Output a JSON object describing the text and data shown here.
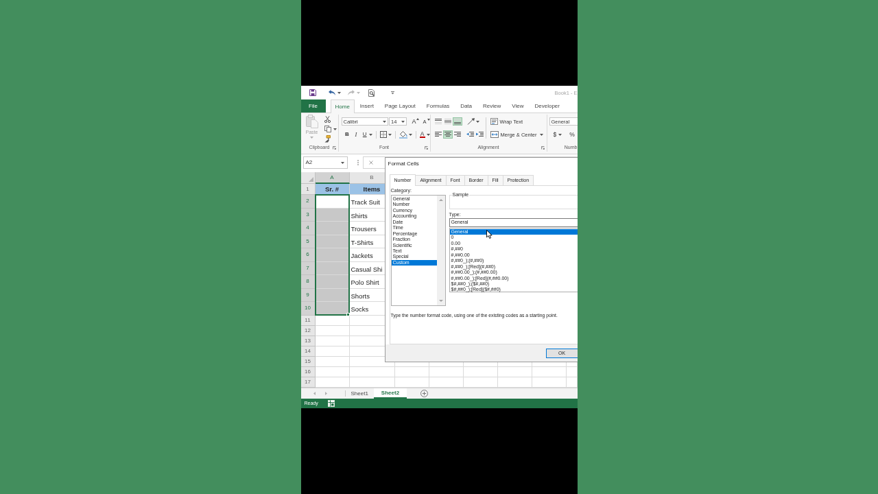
{
  "window": {
    "title": "Book1 - E"
  },
  "quick_access": {
    "undo": {
      "disabled": false
    },
    "redo": {
      "disabled": true
    }
  },
  "ribbon_tabs": [
    {
      "label": "File",
      "kind": "file",
      "selected": false
    },
    {
      "label": "Home",
      "kind": "tab",
      "selected": true
    },
    {
      "label": "Insert",
      "kind": "tab",
      "selected": false
    },
    {
      "label": "Page Layout",
      "kind": "tab",
      "selected": false
    },
    {
      "label": "Formulas",
      "kind": "tab",
      "selected": false
    },
    {
      "label": "Data",
      "kind": "tab",
      "selected": false
    },
    {
      "label": "Review",
      "kind": "tab",
      "selected": false
    },
    {
      "label": "View",
      "kind": "tab",
      "selected": false
    },
    {
      "label": "Developer",
      "kind": "tab",
      "selected": false
    }
  ],
  "ribbon": {
    "clipboard": {
      "label": "Clipboard",
      "paste": {
        "label": "Paste",
        "disabled": true
      }
    },
    "font": {
      "label": "Font",
      "font_name": "Calibri",
      "font_size": "14",
      "grow": "A",
      "shrink": "A",
      "bold": "B",
      "italic": "I",
      "underline": "U",
      "font_color": "A"
    },
    "alignment": {
      "label": "Alignment",
      "vertical": [
        {
          "kind": "top",
          "selected": false
        },
        {
          "kind": "middle",
          "selected": false
        },
        {
          "kind": "bottom",
          "selected": true
        }
      ],
      "horizontal": [
        {
          "kind": "left",
          "selected": false
        },
        {
          "kind": "center",
          "selected": true
        },
        {
          "kind": "right",
          "selected": false
        }
      ],
      "wrap_text": "Wrap Text",
      "merge": "Merge & Center"
    },
    "number": {
      "label": "Numb",
      "format": "General",
      "currency": "$",
      "percent": "%"
    }
  },
  "formula_bar": {
    "name_box": "A2"
  },
  "sheet": {
    "columns": [
      {
        "label": "A",
        "selected": true
      },
      {
        "label": "B",
        "selected": false
      }
    ],
    "rows": [
      {
        "label": "1",
        "selected": false,
        "cells": [
          {
            "kind": "header",
            "text": "Sr. #",
            "selected": false,
            "active": false
          },
          {
            "kind": "header",
            "text": "Items",
            "selected": false,
            "active": false
          }
        ]
      },
      {
        "label": "2",
        "selected": true,
        "cells": [
          {
            "kind": "data",
            "selected": true,
            "active": true
          },
          {
            "kind": "data",
            "text": "Track Suit",
            "selected": false,
            "active": false
          }
        ]
      },
      {
        "label": "3",
        "selected": true,
        "cells": [
          {
            "kind": "data",
            "selected": true,
            "active": false
          },
          {
            "kind": "data",
            "text": "Shirts",
            "selected": false,
            "active": false
          }
        ]
      },
      {
        "label": "4",
        "selected": true,
        "cells": [
          {
            "kind": "data",
            "selected": true,
            "active": false
          },
          {
            "kind": "data",
            "text": "Trousers",
            "selected": false,
            "active": false
          }
        ]
      },
      {
        "label": "5",
        "selected": true,
        "cells": [
          {
            "kind": "data",
            "selected": true,
            "active": false
          },
          {
            "kind": "data",
            "text": "T-Shirts",
            "selected": false,
            "active": false
          }
        ]
      },
      {
        "label": "6",
        "selected": true,
        "cells": [
          {
            "kind": "data",
            "selected": true,
            "active": false
          },
          {
            "kind": "data",
            "text": "Jackets",
            "selected": false,
            "active": false
          }
        ]
      },
      {
        "label": "7",
        "selected": true,
        "cells": [
          {
            "kind": "data",
            "selected": true,
            "active": false
          },
          {
            "kind": "data",
            "text": "Casual Shi",
            "selected": false,
            "active": false
          }
        ]
      },
      {
        "label": "8",
        "selected": true,
        "cells": [
          {
            "kind": "data",
            "selected": true,
            "active": false
          },
          {
            "kind": "data",
            "text": "Polo Shirt",
            "selected": false,
            "active": false
          }
        ]
      },
      {
        "label": "9",
        "selected": true,
        "cells": [
          {
            "kind": "data",
            "selected": true,
            "active": false
          },
          {
            "kind": "data",
            "text": "Shorts",
            "selected": false,
            "active": false
          }
        ]
      },
      {
        "label": "10",
        "selected": true,
        "cells": [
          {
            "kind": "data",
            "selected": true,
            "active": false
          },
          {
            "kind": "data",
            "text": "Socks",
            "selected": false,
            "active": false
          }
        ]
      },
      {
        "label": "11",
        "selected": false
      },
      {
        "label": "12",
        "selected": false
      },
      {
        "label": "13",
        "selected": false
      },
      {
        "label": "14",
        "selected": false
      },
      {
        "label": "15",
        "selected": false
      },
      {
        "label": "16",
        "selected": false
      },
      {
        "label": "17",
        "selected": false
      }
    ]
  },
  "dialog": {
    "title": "Format Cells",
    "tabs": [
      {
        "label": "Number",
        "selected": true
      },
      {
        "label": "Alignment",
        "selected": false
      },
      {
        "label": "Font",
        "selected": false
      },
      {
        "label": "Border",
        "selected": false
      },
      {
        "label": "Fill",
        "selected": false
      },
      {
        "label": "Protection",
        "selected": false
      }
    ],
    "category_label": "Category:",
    "categories": [
      {
        "label": "General",
        "selected": false
      },
      {
        "label": "Number",
        "selected": false
      },
      {
        "label": "Currency",
        "selected": false
      },
      {
        "label": "Accounting",
        "selected": false
      },
      {
        "label": "Date",
        "selected": false
      },
      {
        "label": "Time",
        "selected": false
      },
      {
        "label": "Percentage",
        "selected": false
      },
      {
        "label": "Fraction",
        "selected": false
      },
      {
        "label": "Scientific",
        "selected": false
      },
      {
        "label": "Text",
        "selected": false
      },
      {
        "label": "Special",
        "selected": false
      },
      {
        "label": "Custom",
        "selected": true
      }
    ],
    "sample_label": "Sample",
    "type_label": "Type:",
    "type_value": "General",
    "types": [
      {
        "label": "General",
        "selected": true
      },
      {
        "label": "0",
        "selected": false
      },
      {
        "label": "0.00",
        "selected": false
      },
      {
        "label": "#,##0",
        "selected": false
      },
      {
        "label": "#,##0.00",
        "selected": false
      },
      {
        "label": "#,##0_);(#,##0)",
        "selected": false
      },
      {
        "label": "#,##0_);[Red](#,##0)",
        "selected": false
      },
      {
        "label": "#,##0.00_);(#,##0.00)",
        "selected": false
      },
      {
        "label": "#,##0.00_);[Red](#,##0.00)",
        "selected": false
      },
      {
        "label": "$#,##0_);($#,##0)",
        "selected": false
      },
      {
        "label": "$#,##0_);[Red]($#,##0)",
        "selected": false
      }
    ],
    "hint": "Type the number format code, using one of the existing codes as a starting point.",
    "ok": "OK"
  },
  "sheet_tabs": [
    {
      "label": "Sheet1",
      "selected": false
    },
    {
      "label": "Sheet2",
      "selected": true
    }
  ],
  "status_bar": {
    "text": "Ready"
  }
}
